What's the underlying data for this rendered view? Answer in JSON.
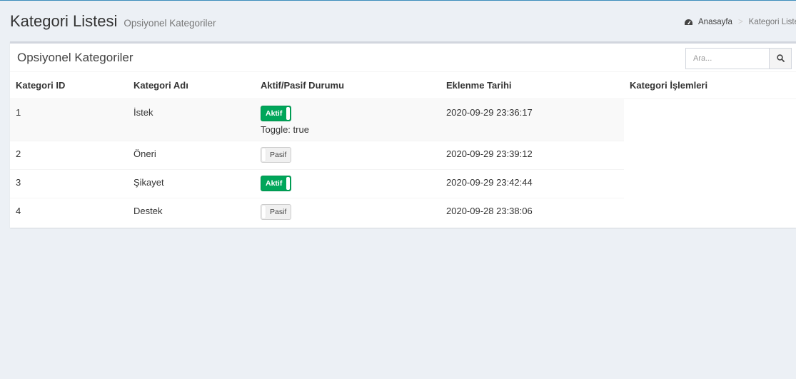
{
  "header": {
    "title": "Kategori Listesi",
    "subtitle": "Opsiyonel Kategoriler"
  },
  "breadcrumb": {
    "home_label": "Anasayfa",
    "home_icon": "dashboard-icon",
    "current": "Kategori Listesi"
  },
  "box": {
    "title": "Opsiyonel Kategoriler",
    "search": {
      "placeholder": "Ara...",
      "value": "",
      "icon": "search-icon"
    }
  },
  "table": {
    "columns": [
      "Kategori ID",
      "Kategori Adı",
      "Aktif/Pasif Durumu",
      "Eklenme Tarihi",
      "Kategori İşlemleri"
    ],
    "rows": [
      {
        "id": "1",
        "name": "İstek",
        "status": "Aktif",
        "active": true,
        "toggle_text": "Toggle: true",
        "date": "2020-09-29 23:36:17"
      },
      {
        "id": "2",
        "name": "Öneri",
        "status": "Pasif",
        "active": false,
        "date": "2020-09-29 23:39:12"
      },
      {
        "id": "3",
        "name": "Şikayet",
        "status": "Aktif",
        "active": true,
        "date": "2020-09-29 23:42:44"
      },
      {
        "id": "4",
        "name": "Destek",
        "status": "Pasif",
        "active": false,
        "date": "2020-09-28 23:38:06"
      }
    ]
  },
  "colors": {
    "accent": "#3c8dbc",
    "active_toggle": "#00a65a",
    "background": "#ecf0f5"
  }
}
